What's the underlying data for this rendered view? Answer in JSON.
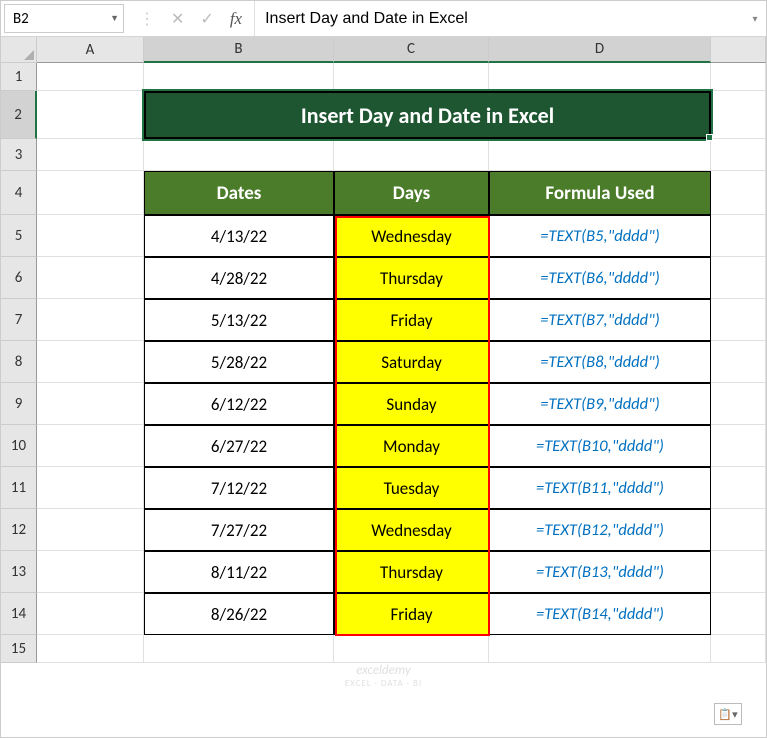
{
  "nameBox": "B2",
  "formulaBar": {
    "value": "Insert Day and Date in Excel"
  },
  "columns": {
    "A": "A",
    "B": "B",
    "C": "C",
    "D": "D",
    "E": ""
  },
  "rowLabels": [
    "1",
    "2",
    "3",
    "4",
    "5",
    "6",
    "7",
    "8",
    "9",
    "10",
    "11",
    "12",
    "13",
    "14",
    "15"
  ],
  "title": "Insert Day and Date in Excel",
  "headers": {
    "dates": "Dates",
    "days": "Days",
    "formula": "Formula Used"
  },
  "chart_data": {
    "type": "table",
    "title": "Insert Day and Date in Excel",
    "columns": [
      "Dates",
      "Days",
      "Formula Used"
    ],
    "rows": [
      {
        "date": "4/13/22",
        "day": "Wednesday",
        "formula": "=TEXT(B5,\"dddd\")"
      },
      {
        "date": "4/28/22",
        "day": "Thursday",
        "formula": "=TEXT(B6,\"dddd\")"
      },
      {
        "date": "5/13/22",
        "day": "Friday",
        "formula": "=TEXT(B7,\"dddd\")"
      },
      {
        "date": "5/28/22",
        "day": "Saturday",
        "formula": "=TEXT(B8,\"dddd\")"
      },
      {
        "date": "6/12/22",
        "day": "Sunday",
        "formula": "=TEXT(B9,\"dddd\")"
      },
      {
        "date": "6/27/22",
        "day": "Monday",
        "formula": "=TEXT(B10,\"dddd\")"
      },
      {
        "date": "7/12/22",
        "day": "Tuesday",
        "formula": "=TEXT(B11,\"dddd\")"
      },
      {
        "date": "7/27/22",
        "day": "Wednesday",
        "formula": "=TEXT(B12,\"dddd\")"
      },
      {
        "date": "8/11/22",
        "day": "Thursday",
        "formula": "=TEXT(B13,\"dddd\")"
      },
      {
        "date": "8/26/22",
        "day": "Friday",
        "formula": "=TEXT(B14,\"dddd\")"
      }
    ]
  },
  "watermark": {
    "line1": "exceldemy",
    "line2": "EXCEL · DATA · BI"
  }
}
